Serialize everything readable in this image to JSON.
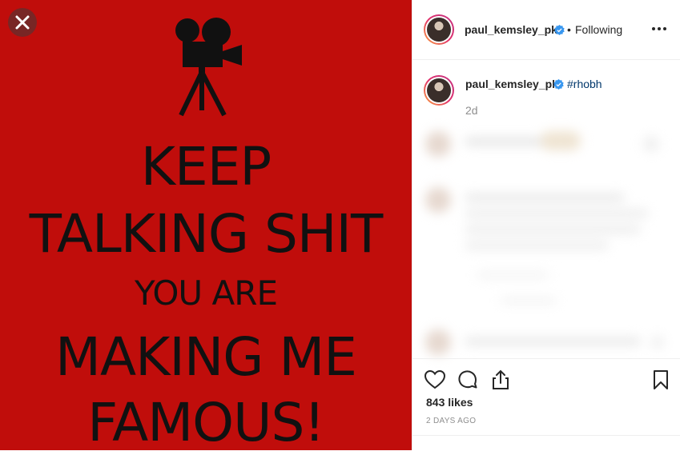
{
  "poster": {
    "line1": "KEEP",
    "line2": "TALKING SHIT",
    "line3": "YOU ARE",
    "line4": "MAKING ME",
    "line5": "FAMOUS!"
  },
  "header": {
    "username": "paul_kemsley_pk",
    "separator": "•",
    "follow_status": "Following"
  },
  "caption": {
    "username": "paul_kemsley_pk",
    "hashtag": "#rhobh",
    "time_ago": "2d"
  },
  "stats": {
    "likes": "843 likes",
    "date": "2 DAYS AGO"
  },
  "colors": {
    "poster_background": "#c00d0b",
    "verified_blue": "#3897f0",
    "link": "#00376b"
  },
  "icons": [
    "close-icon",
    "camera-tripod-icon",
    "verified-badge-icon",
    "more-options-icon",
    "heart-icon",
    "comment-icon",
    "share-icon",
    "bookmark-icon"
  ]
}
